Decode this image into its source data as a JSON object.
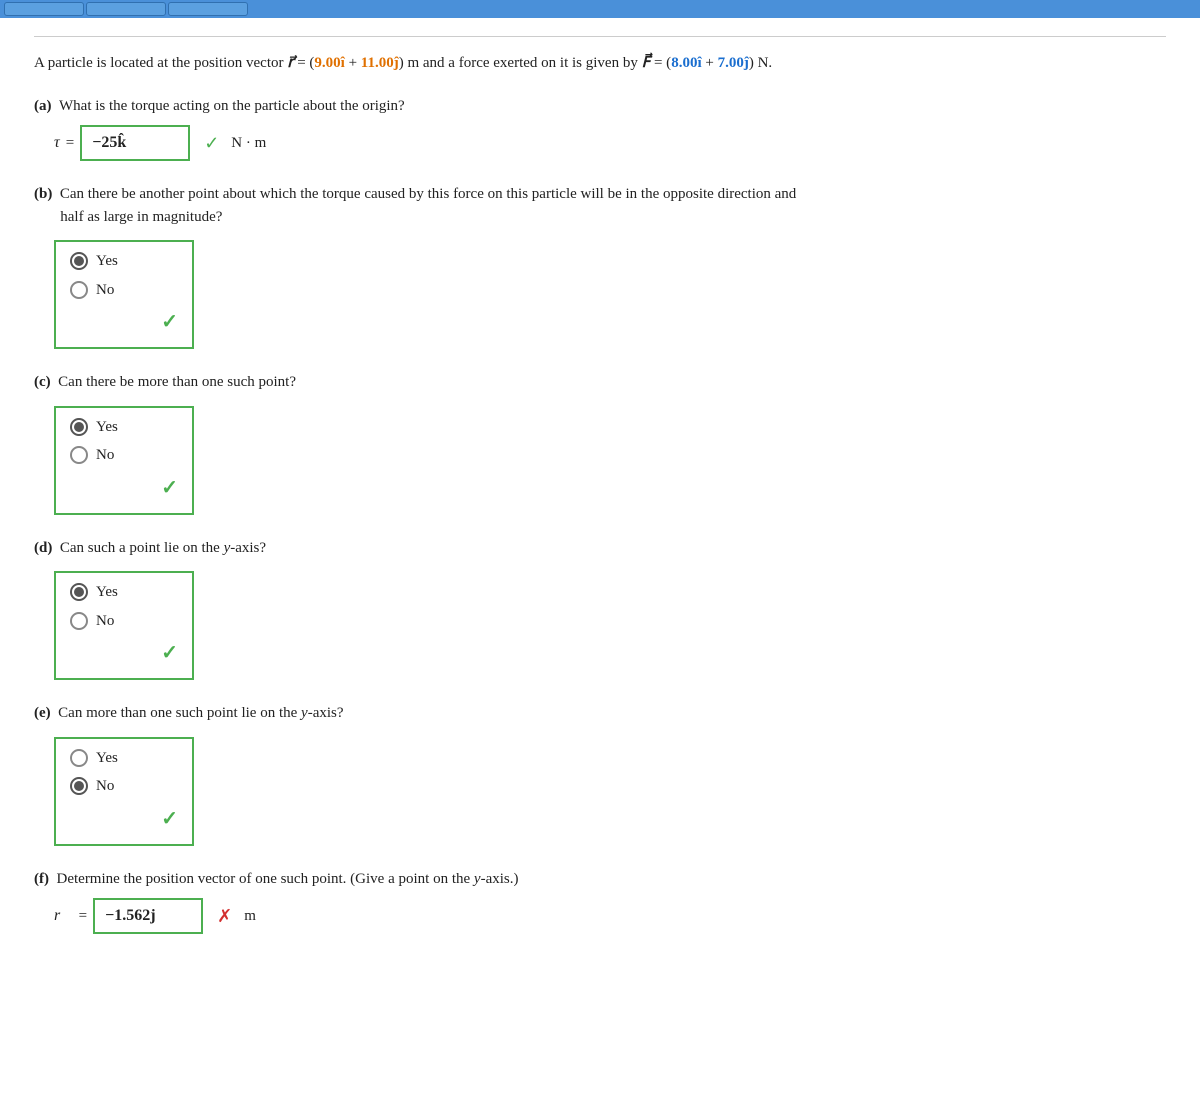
{
  "topbar": {
    "buttons": [
      "btn1",
      "btn2",
      "btn3"
    ]
  },
  "problem": {
    "statement": "A particle is located at the position vector r = (9.00î + 11.00ĵ) m and a force exerted on it is given by F = (8.00î + 7.00ĵ) N.",
    "r_coeff1": "9.00",
    "r_coeff2": "11.00",
    "F_coeff1": "8.00",
    "F_coeff2": "7.00"
  },
  "parts": {
    "a": {
      "label": "(a)  What is the torque acting on the particle about the origin?",
      "answer": "−25k̂",
      "unit": "N · m",
      "correct": true
    },
    "b": {
      "label": "Can there be another point about which the torque caused by this force on this particle will be in the opposite direction and half as large in magnitude?",
      "options": [
        "Yes",
        "No"
      ],
      "selected": "Yes",
      "correct": true
    },
    "c": {
      "label": "Can there be more than one such point?",
      "options": [
        "Yes",
        "No"
      ],
      "selected": "Yes",
      "correct": true
    },
    "d": {
      "label": "Can such a point lie on the y-axis?",
      "options": [
        "Yes",
        "No"
      ],
      "selected": "Yes",
      "correct": true
    },
    "e": {
      "label": "Can more than one such point lie on the y-axis?",
      "options": [
        "Yes",
        "No"
      ],
      "selected": "No",
      "correct": true
    },
    "f": {
      "label": "Determine the position vector of one such point. (Give a point on the y-axis.)",
      "answer": "−1.562j",
      "unit": "m",
      "correct": false
    }
  },
  "icons": {
    "check": "✓",
    "x": "✗",
    "arrow": "→"
  }
}
